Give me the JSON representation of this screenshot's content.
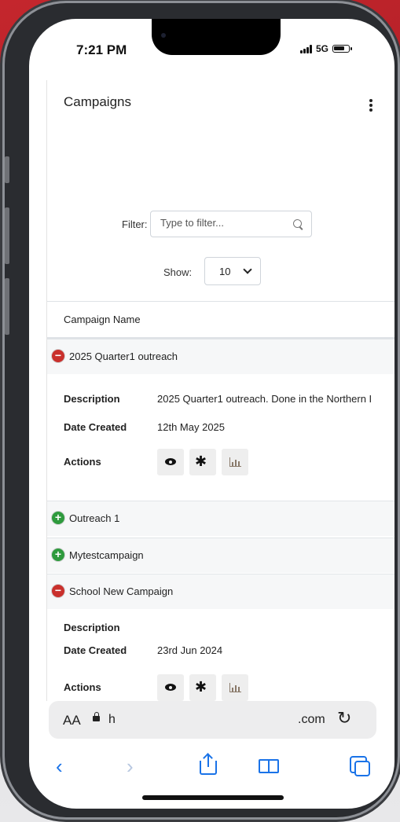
{
  "status": {
    "time": "7:21 PM",
    "network": "5G",
    "battery_level": 0.8
  },
  "page": {
    "title": "Campaigns",
    "filter": {
      "label": "Filter:",
      "placeholder": "Type to filter..."
    },
    "show": {
      "label": "Show:",
      "value": "10"
    },
    "column_header": "Campaign Name"
  },
  "campaigns": [
    {
      "name": "2025 Quarter1 outreach",
      "expanded": true,
      "description_label": "Description",
      "description": "2025 Quarter1 outreach. Done in the Northern I",
      "date_label": "Date Created",
      "date": "12th May 2025",
      "actions_label": "Actions"
    },
    {
      "name": "Outreach 1",
      "expanded": false
    },
    {
      "name": "Mytestcampaign",
      "expanded": false
    },
    {
      "name": "School New Campaign",
      "expanded": true,
      "description_label": "Description",
      "description": "",
      "date_label": "Date Created",
      "date": "23rd Jun 2024",
      "actions_label": "Actions"
    }
  ],
  "browser": {
    "aa_label": "AA",
    "url_start": "h",
    "url_end": ".com",
    "icons": [
      "lock-icon",
      "reload-icon",
      "back-icon",
      "forward-icon",
      "share-icon",
      "bookmarks-icon",
      "tabs-icon"
    ]
  },
  "colors": {
    "collapse": "#c9302c",
    "expand": "#2e9a3d",
    "toolbar": "#1a73e8",
    "backdrop": "#c4262d"
  }
}
